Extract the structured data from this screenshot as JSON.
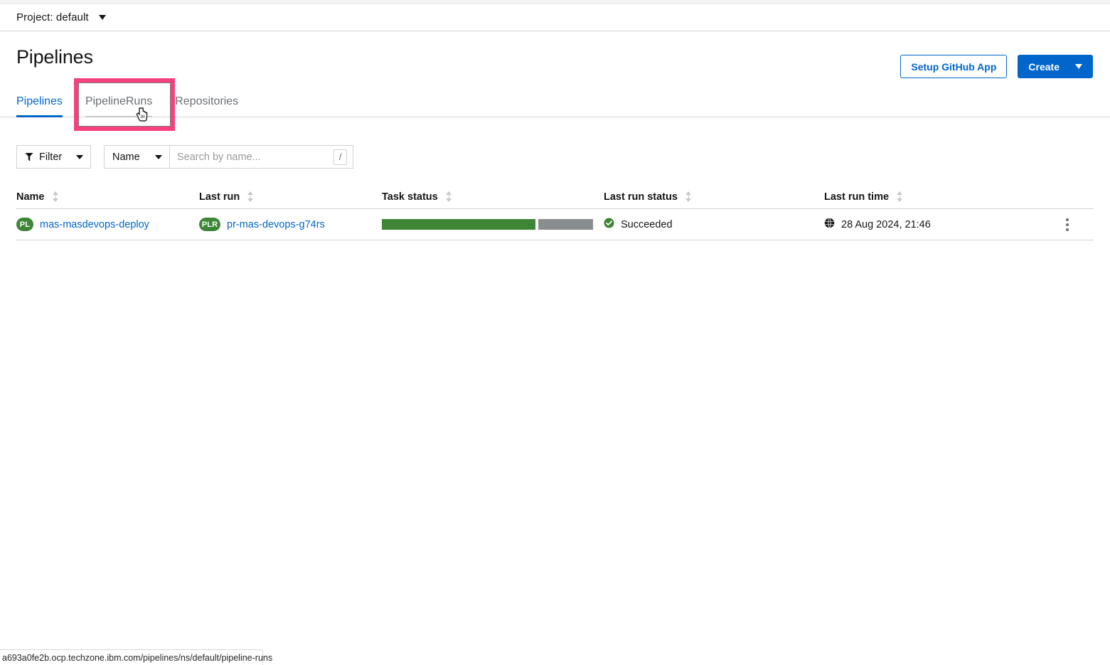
{
  "topbar": {
    "project_label": "Project: default",
    "caret_icon": "chevron-down-icon"
  },
  "header": {
    "title": "Pipelines",
    "setup_github_label": "Setup GitHub App",
    "create_label": "Create"
  },
  "tabs": [
    {
      "label": "Pipelines",
      "state": "active"
    },
    {
      "label": "PipelineRuns",
      "state": "hovered"
    },
    {
      "label": "Repositories",
      "state": "default"
    }
  ],
  "toolbar": {
    "filter_label": "Filter",
    "filter_icon": "funnel-icon",
    "attribute_label": "Name",
    "search_placeholder": "Search by name...",
    "search_value": "",
    "shortcut_key": "/"
  },
  "table": {
    "columns": [
      {
        "label": "Name"
      },
      {
        "label": "Last run"
      },
      {
        "label": "Task status"
      },
      {
        "label": "Last run status"
      },
      {
        "label": "Last run time"
      }
    ],
    "rows": [
      {
        "name_badge": "PL",
        "name": "mas-masdevops-deploy",
        "lastrun_badge": "PLR",
        "lastrun": "pr-mas-devops-g74rs",
        "task_status": {
          "completed": 6,
          "total": 8
        },
        "last_run_status": "Succeeded",
        "last_run_status_icon": "check-circle-icon",
        "last_run_time": "28 Aug 2024, 21:46",
        "last_run_time_icon": "globe-icon",
        "actions_icon": "kebab-menu-icon"
      }
    ]
  },
  "statusbar": {
    "url": "a693a0fe2b.ocp.techzone.ibm.com/pipelines/ns/default/pipeline-runs"
  },
  "colors": {
    "accent_blue": "#0066cc",
    "success_green": "#3e8635",
    "pending_gray": "#8a8d90",
    "highlight_pink": "#f6407f"
  }
}
